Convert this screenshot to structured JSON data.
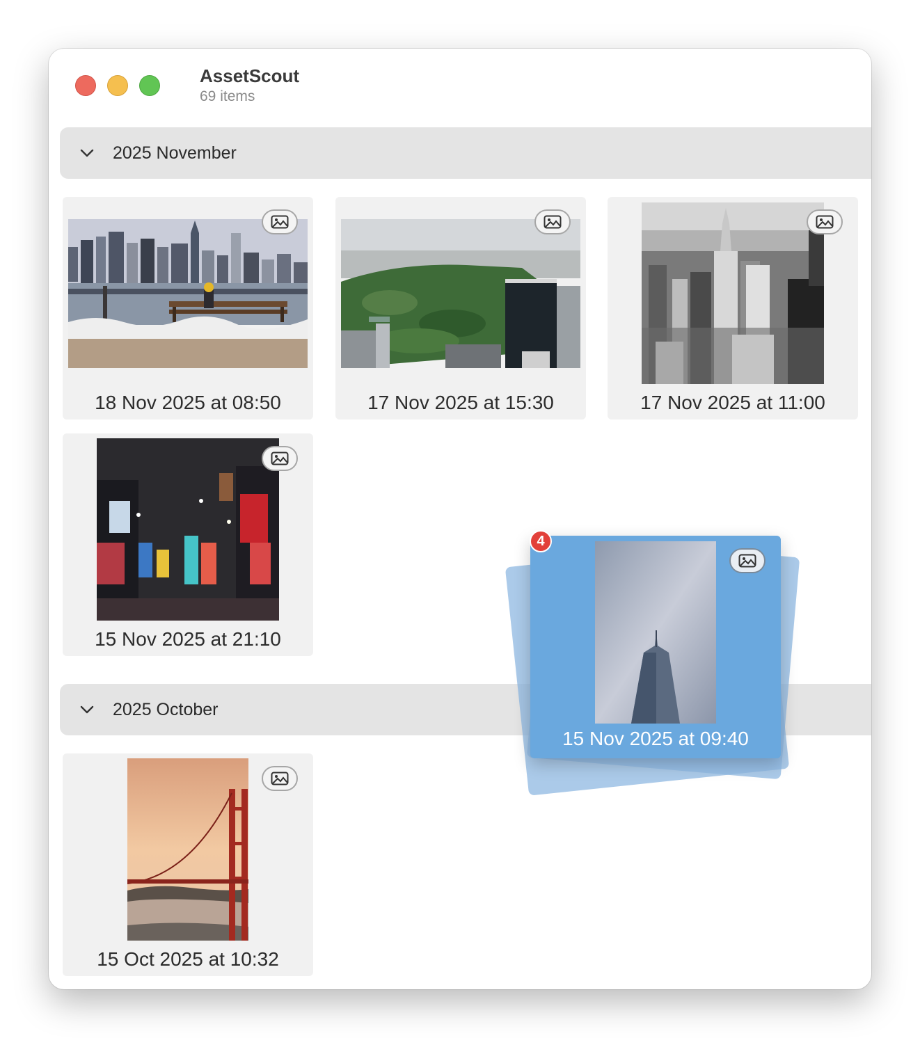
{
  "window": {
    "title": "AssetScout",
    "item_count": "69 items"
  },
  "sections": [
    {
      "label": "2025 November",
      "items": [
        {
          "caption": "18 Nov 2025 at 08:50",
          "image": "skyline-bench-photo"
        },
        {
          "caption": "17 Nov 2025 at 15:30",
          "image": "central-park-aerial-photo"
        },
        {
          "caption": "17 Nov 2025 at 11:00",
          "image": "empire-state-bw-photo"
        },
        {
          "caption": "15 Nov 2025 at 21:10",
          "image": "times-square-night-photo"
        }
      ]
    },
    {
      "label": "2025 October",
      "items": [
        {
          "caption": "15 Oct 2025 at 10:32",
          "image": "golden-gate-bridge-photo"
        }
      ]
    }
  ],
  "drag": {
    "count": "4",
    "caption": "15 Nov 2025 at 09:40",
    "image": "one-world-trade-photo"
  },
  "icons": {
    "media_type": "photo-icon",
    "section_toggle": "chevron-down-icon"
  },
  "colors": {
    "selection": "#6aa8de",
    "count_badge": "#e2403a"
  }
}
